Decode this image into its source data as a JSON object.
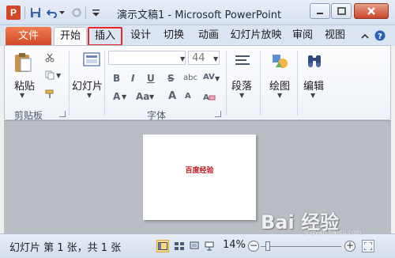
{
  "window": {
    "title": "演示文稿1 - Microsoft PowerPoint",
    "app_icon_letter": "P"
  },
  "tabs": {
    "file": "文件",
    "items": [
      "开始",
      "插入",
      "设计",
      "切换",
      "动画",
      "幻灯片放映",
      "审阅",
      "视图"
    ],
    "active": "开始",
    "highlighted": "插入"
  },
  "ribbon": {
    "clipboard": {
      "paste_label": "粘贴",
      "group_label": "剪贴板"
    },
    "slides": {
      "new_slide_label": "幻灯片"
    },
    "font": {
      "group_label": "字体",
      "font_size": "44",
      "bold": "B",
      "italic": "I",
      "underline": "U",
      "strikethrough": "S",
      "shadow": "abc",
      "spacing": "AV",
      "change_case": "Aa",
      "text_color": "A",
      "grow": "A",
      "shrink": "A"
    },
    "paragraph": {
      "label": "段落"
    },
    "drawing": {
      "label": "绘图"
    },
    "editing": {
      "label": "编辑"
    }
  },
  "slide": {
    "text": "百度经验"
  },
  "statusbar": {
    "slide_info": "幻灯片 第 1 张，共 1 张",
    "zoom": "14%"
  },
  "watermark": {
    "text": "Bai 经验",
    "sub": "jingyan.baidu.com"
  },
  "colors": {
    "file_tab": "#d24726",
    "highlight_border": "#e8262a",
    "slide_text": "#c0181d",
    "workspace": "#b9bdc4"
  }
}
